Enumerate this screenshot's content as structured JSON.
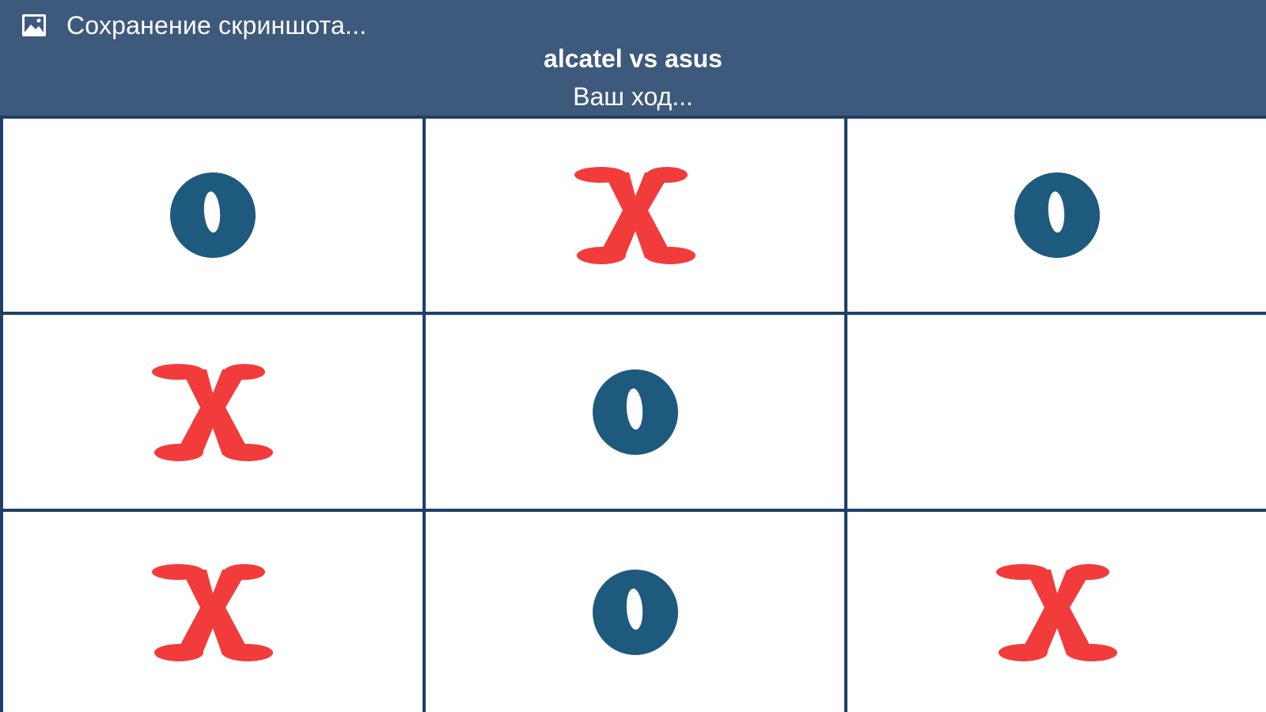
{
  "notification": {
    "icon": "image-icon",
    "text": "Сохранение скриншота..."
  },
  "game": {
    "title": "alcatel vs asus",
    "status": "Ваш ход..."
  },
  "colors": {
    "header": "#3d5a7c",
    "grid_lines": "#1f3f6a",
    "x_mark": "#f23b3b",
    "o_mark": "#1e5a7e",
    "cell_bg": "#ffffff"
  },
  "board": [
    [
      "O",
      "X",
      "O"
    ],
    [
      "X",
      "O",
      ""
    ],
    [
      "X",
      "O",
      "X"
    ]
  ]
}
